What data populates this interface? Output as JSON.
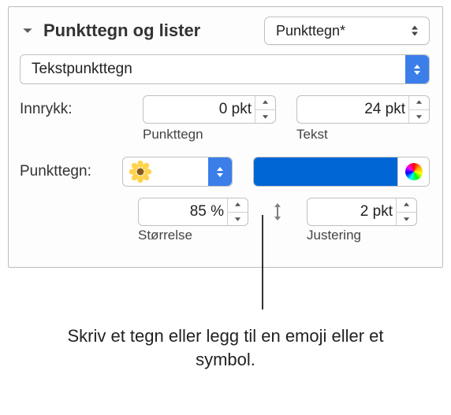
{
  "header": {
    "title": "Punkttegn og lister",
    "style_popup": "Punkttegn*"
  },
  "type_popup": "Tekstpunkttegn",
  "indent": {
    "label": "Innrykk:",
    "bullet_value": "0 pkt",
    "bullet_sublabel": "Punkttegn",
    "text_value": "24 pkt",
    "text_sublabel": "Tekst"
  },
  "bullet": {
    "label": "Punkttegn:",
    "size_value": "85 %",
    "size_sublabel": "Størrelse",
    "align_value": "2 pkt",
    "align_sublabel": "Justering"
  },
  "color_hex": "#0066d6",
  "caption": "Skriv et tegn eller legg til en emoji eller et symbol."
}
